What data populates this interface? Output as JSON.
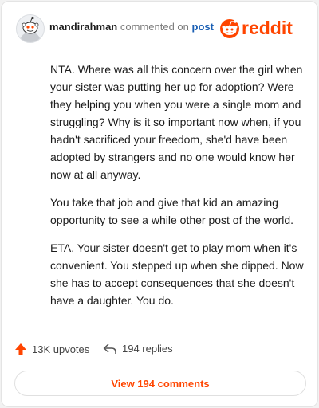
{
  "comment": {
    "username": "mandirahman",
    "verb": "commented on",
    "target": "post",
    "paragraphs": [
      "NTA. Where was all this concern over the girl when your sister was putting her up for adoption? Were they helping you when you were a single mom and struggling? Why is it so important now when, if you hadn't sacrificed your freedom, she'd have been adopted by strangers and no one would know her now at all anyway.",
      "You take that job and give that kid an amazing opportunity to see a while other post of the world.",
      "ETA, Your sister doesn't get to play mom when it's convenient. You stepped up when she dipped. Now she has to accept consequences that she doesn't have a daughter. You do."
    ]
  },
  "brand": {
    "wordmark": "reddit",
    "color": "#ff4500"
  },
  "actions": {
    "upvotes": "13K upvotes",
    "replies": "194 replies",
    "upvote_icon": "upvote-arrow-icon",
    "reply_icon": "reply-arrow-icon"
  },
  "view_comments": "View 194 comments"
}
